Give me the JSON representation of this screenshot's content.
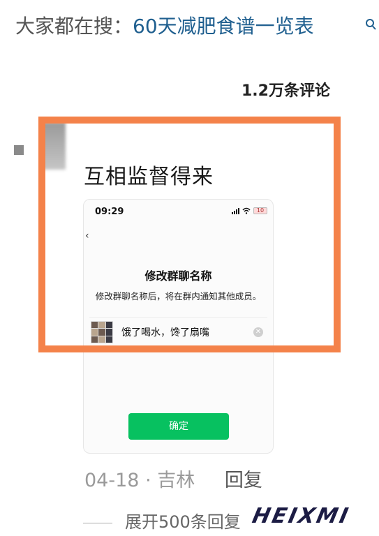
{
  "search": {
    "prefix": "大家都在搜：",
    "term": "60天减肥食谱一览表",
    "icon": "search-icon"
  },
  "comments": {
    "count_label": "1.2万条评论"
  },
  "comment": {
    "text": "互相监督得来",
    "date": "04-18",
    "separator": "·",
    "location": "吉林",
    "reply_label": "回复"
  },
  "screenshot": {
    "status_time": "09:29",
    "battery_level": "10",
    "back_icon": "chevron-left-icon",
    "dialog_title": "修改群聊名称",
    "dialog_description": "修改群聊名称后，将在群内通知其他成员。",
    "group_name_value": "饿了喝水，馋了扇嘴",
    "clear_icon": "close-icon",
    "confirm_label": "确定",
    "accent_color": "#07c160"
  },
  "replies": {
    "expand_label": "展开500条回复"
  },
  "highlight": {
    "border_color": "#f4824a"
  },
  "watermark": {
    "text": "HEIXMI"
  }
}
